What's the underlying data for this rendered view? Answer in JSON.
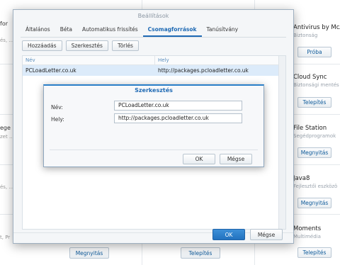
{
  "background": {
    "left_fragments": [
      {
        "text": "for"
      },
      {
        "text": "és, ..."
      },
      {
        "text": "ege"
      },
      {
        "text": "zet ..."
      },
      {
        "text": "és, ..."
      },
      {
        "text": "t, Pr"
      }
    ],
    "packages": [
      {
        "name": "Antivirus by McAf",
        "category": "Biztonság",
        "button": "Próba"
      },
      {
        "name": "Cloud Sync",
        "category": "Biztonsági mentés",
        "button": "Telepítés"
      },
      {
        "name": "File Station",
        "category": "Segédprogramok",
        "button": "Megnyitás"
      },
      {
        "name": "Java8",
        "category": "Fejlesztői eszközö",
        "button": "Megnyitás"
      },
      {
        "name": "Moments",
        "category": "Multimédia",
        "button": "Telepítés"
      }
    ],
    "bottom_buttons": [
      "Megnyitás",
      "Telepítés"
    ]
  },
  "settings": {
    "title": "Beállítások",
    "tabs": [
      "Általános",
      "Béta",
      "Automatikus frissítés",
      "Csomagforrások",
      "Tanúsítvány"
    ],
    "active_tab": "Csomagforrások",
    "toolbar": {
      "add": "Hozzáadás",
      "edit": "Szerkesztés",
      "delete": "Törlés"
    },
    "grid": {
      "columns": [
        "Név",
        "Hely"
      ],
      "rows": [
        {
          "name": "PCLoadLetter.co.uk",
          "location": "http://packages.pcloadletter.co.uk"
        }
      ]
    },
    "ok": "OK",
    "cancel": "Mégse"
  },
  "dialog": {
    "title": "Szerkesztés",
    "name_label": "Név:",
    "name_value": "PCLoadLetter.co.uk",
    "location_label": "Hely:",
    "location_value": "http://packages.pcloadletter.co.uk",
    "ok": "OK",
    "cancel": "Mégse"
  },
  "colors": {
    "accent": "#1f6ab4",
    "primary_button": "#2a7fc8",
    "selected_row": "#dcebfa"
  }
}
